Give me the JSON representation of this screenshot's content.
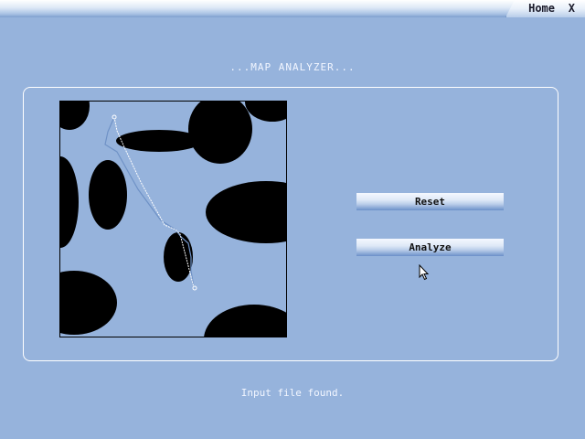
{
  "topbar": {
    "home_label": "Home",
    "close_label": "X"
  },
  "title": "...MAP ANALYZER...",
  "buttons": {
    "reset_label": "Reset",
    "analyze_label": "Analyze"
  },
  "status": "Input file found.",
  "colors": {
    "background": "#96b3dc",
    "obstacle": "#000000",
    "path": "#ffffff"
  },
  "icons": {
    "cursor": "mouse-pointer-icon"
  }
}
